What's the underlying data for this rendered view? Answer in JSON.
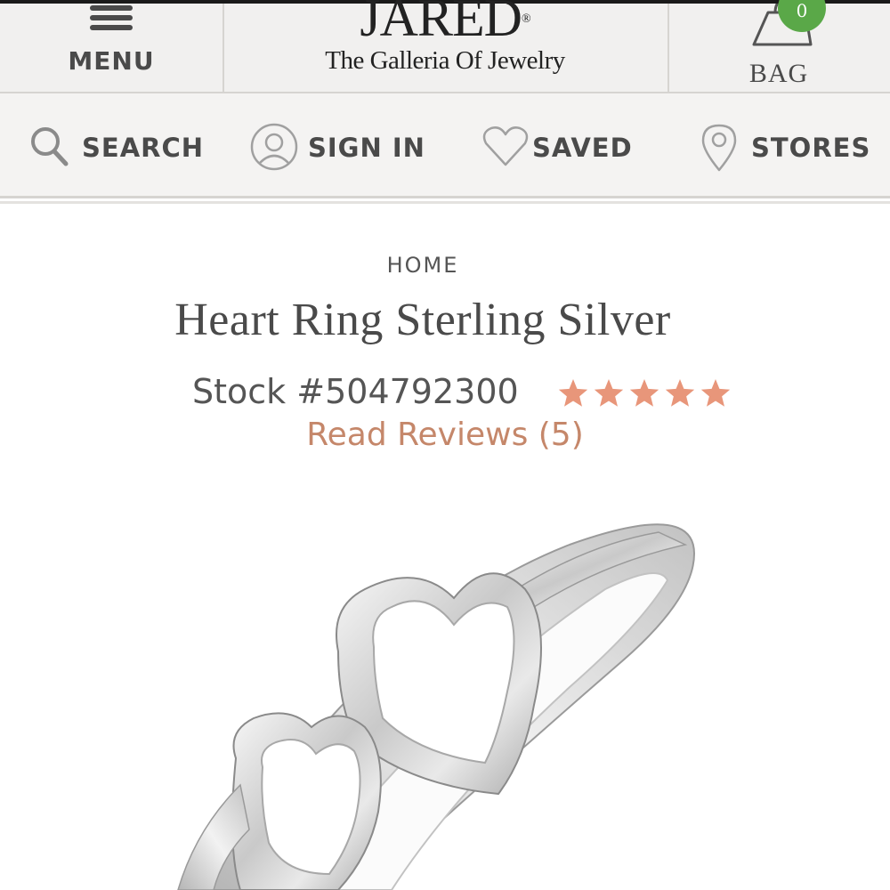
{
  "header": {
    "menu_label": "MENU",
    "logo_text": "JARED",
    "logo_mark": "®",
    "tagline": "The Galleria Of Jewelry",
    "bag_label": "BAG",
    "bag_count": "0",
    "bag_count_color": "#5aa848"
  },
  "utility_nav": [
    {
      "label": "SEARCH",
      "icon": "search-icon"
    },
    {
      "label": "SIGN IN",
      "icon": "user-icon"
    },
    {
      "label": "SAVED",
      "icon": "heart-icon"
    },
    {
      "label": "STORES",
      "icon": "location-pin-icon"
    }
  ],
  "product": {
    "breadcrumb": "HOME",
    "title": "Heart Ring Sterling Silver",
    "stock": "Stock #504792300",
    "rating": 5,
    "rating_max": 5,
    "star_color": "#e8967a",
    "reviews_link": "Read Reviews (5)",
    "accent_color": "#c5876a"
  }
}
